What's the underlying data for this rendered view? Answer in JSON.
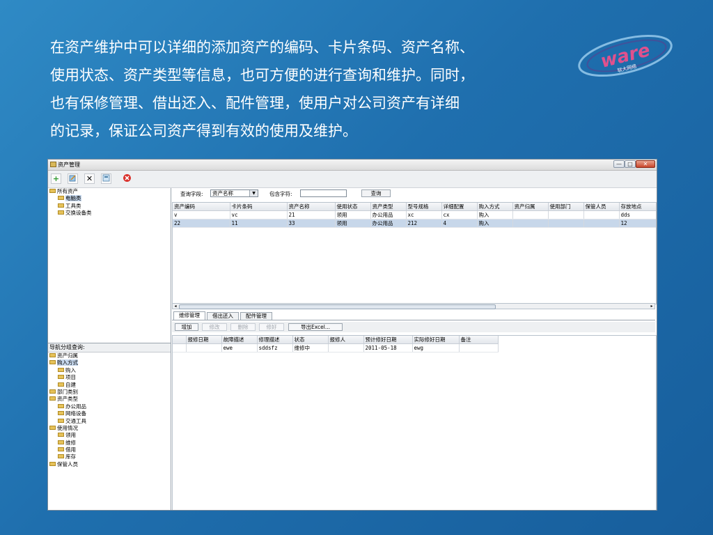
{
  "slide": {
    "lines": [
      "在资产维护中可以详细的添加资产的编码、卡片条码、资产名称、",
      "使用状态、资产类型等信息，也可方便的进行查询和维护。同时，",
      "也有保修管理、借出还入、配件管理，使用户对公司资产有详细",
      "的记录，保证公司资产得到有效的使用及维护。"
    ],
    "logo": {
      "text": "ware",
      "subtitle": "软大网络"
    }
  },
  "window": {
    "title": "资产管理",
    "controls": [
      "—",
      "□",
      "✕"
    ]
  },
  "toolbar": {
    "icons": [
      "add-icon",
      "edit-icon",
      "delete-icon",
      "export-icon",
      "close-icon"
    ]
  },
  "asset_tree": {
    "root": "所有资产",
    "children": [
      "电脑类",
      "工具类",
      "交换设备类"
    ],
    "selected": "电脑类"
  },
  "nav": {
    "title": "导航分组查询:",
    "items": [
      {
        "label": "资产归属",
        "level": 0
      },
      {
        "label": "购入方式",
        "level": 0,
        "selected": true
      },
      {
        "label": "购入",
        "level": 1
      },
      {
        "label": "项目",
        "level": 1
      },
      {
        "label": "自建",
        "level": 1
      },
      {
        "label": "部门类别",
        "level": 0
      },
      {
        "label": "资产类型",
        "level": 0
      },
      {
        "label": "办公用品",
        "level": 1
      },
      {
        "label": "网络设备",
        "level": 1
      },
      {
        "label": "交通工具",
        "level": 1
      },
      {
        "label": "使用情况",
        "level": 0
      },
      {
        "label": "领用",
        "level": 1
      },
      {
        "label": "维修",
        "level": 1
      },
      {
        "label": "借用",
        "level": 1
      },
      {
        "label": "库存",
        "level": 1
      },
      {
        "label": "保管人员",
        "level": 0
      }
    ]
  },
  "query": {
    "field_label": "查询字段:",
    "field_value": "资产名称",
    "contains_label": "包含字符:",
    "contains_value": "",
    "search_button": "查询"
  },
  "asset_table": {
    "columns": [
      "资产编码",
      "卡片条码",
      "资产名称",
      "使用状态",
      "资产类型",
      "型号规格",
      "详细配置",
      "购入方式",
      "资产归属",
      "使用部门",
      "保管人员",
      "存放地点"
    ],
    "rows": [
      [
        "v",
        "vc",
        "21",
        "领用",
        "办公用品",
        "xc",
        "cx",
        "购入",
        "",
        "",
        "",
        "dds"
      ],
      [
        "22",
        "11",
        "33",
        "领用",
        "办公用品",
        "212",
        "4",
        "购入",
        "",
        "",
        "",
        "12"
      ]
    ],
    "selected_row": 1
  },
  "tabs": {
    "items": [
      "维修管理",
      "借出还入",
      "配件管理"
    ],
    "active": 0
  },
  "repair_buttons": {
    "items": [
      {
        "label": "增加",
        "enabled": true
      },
      {
        "label": "修改",
        "enabled": false
      },
      {
        "label": "删除",
        "enabled": false
      },
      {
        "label": "修好",
        "enabled": false
      },
      {
        "label": "导出Excel...",
        "enabled": true
      }
    ]
  },
  "repair_table": {
    "columns": [
      "",
      "报修日期",
      "故障描述",
      "修理描述",
      "状态",
      "报修人",
      "预计修好日期",
      "实际修好日期",
      "备注"
    ],
    "rows": [
      [
        "",
        "",
        "ewe",
        "sddsfz",
        "维修中",
        "",
        "2011-05-18",
        "ewg",
        ""
      ]
    ]
  }
}
